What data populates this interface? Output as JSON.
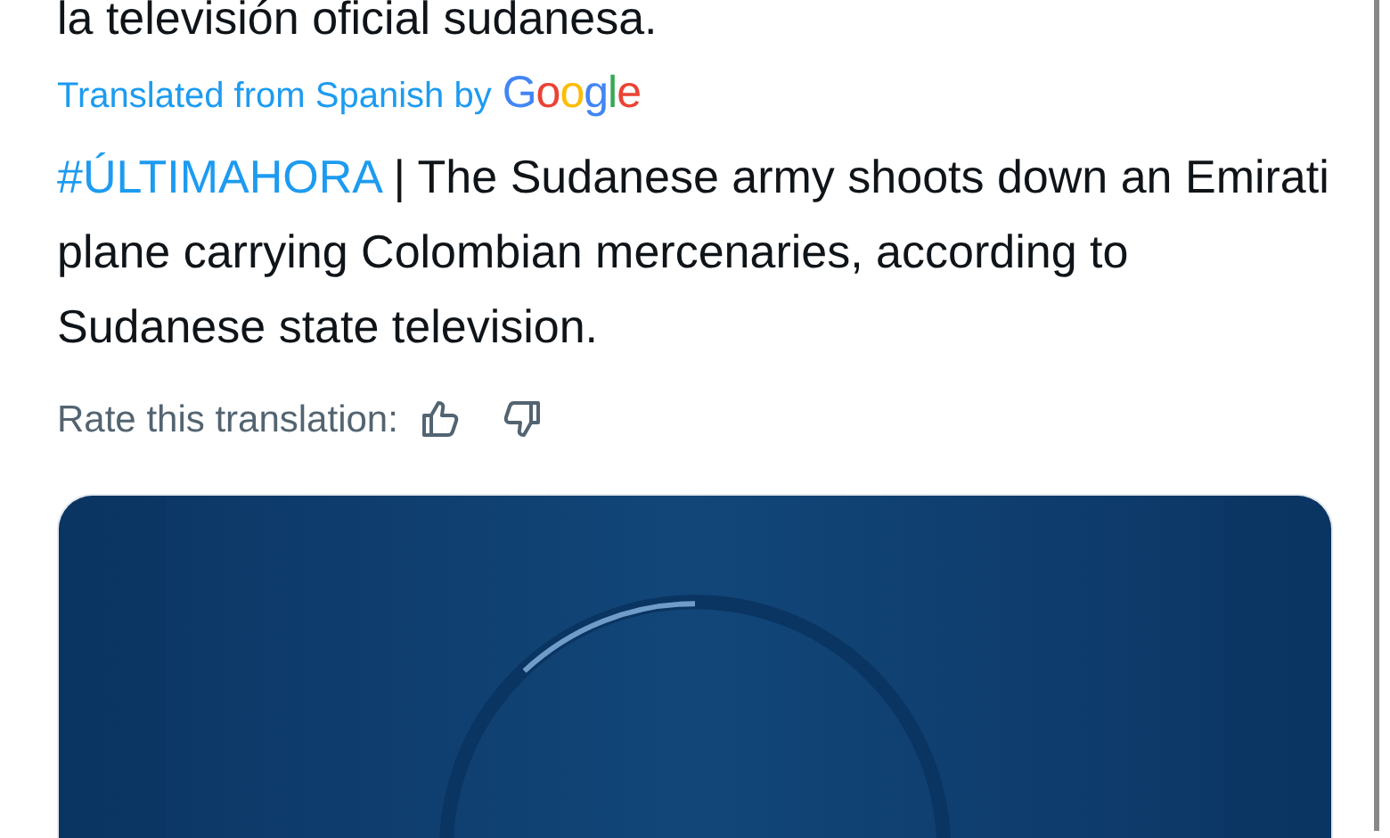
{
  "original_text_tail": "la televisión oficial sudanesa.",
  "translation": {
    "label": "Translated from Spanish by",
    "provider": "Google"
  },
  "translated_text": {
    "hashtag": "#ÚLTIMAHORA",
    "text": " | The Sudanese army shoots down an Emirati plane carrying Colombian mercenaries, according to Sudanese state television."
  },
  "rating": {
    "label": "Rate this translation:"
  }
}
